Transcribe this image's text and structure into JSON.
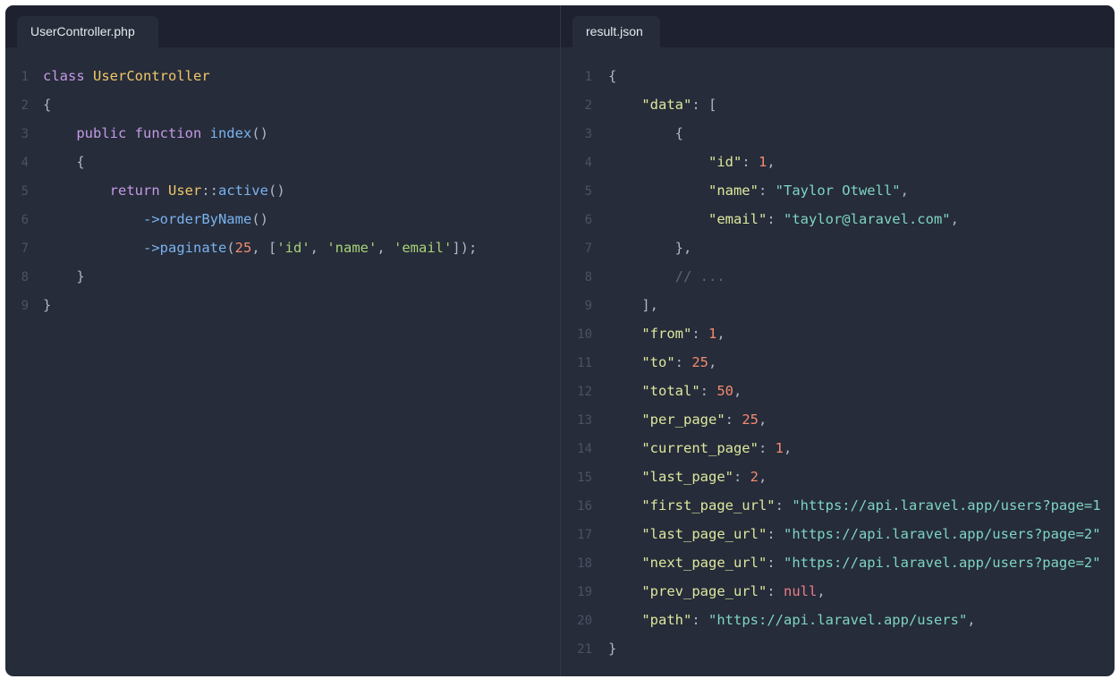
{
  "left_tab": {
    "label": "UserController.php"
  },
  "right_tab": {
    "label": "result.json"
  },
  "php_lines": [
    [
      {
        "t": "class ",
        "c": "kw"
      },
      {
        "t": "UserController",
        "c": "cls"
      }
    ],
    [
      {
        "t": "{",
        "c": "pun"
      }
    ],
    [
      {
        "t": "    public function ",
        "c": "kw"
      },
      {
        "t": "index",
        "c": "fn"
      },
      {
        "t": "()",
        "c": "pun"
      }
    ],
    [
      {
        "t": "    {",
        "c": "pun"
      }
    ],
    [
      {
        "t": "        return ",
        "c": "kw"
      },
      {
        "t": "User",
        "c": "cls"
      },
      {
        "t": "::",
        "c": "pun"
      },
      {
        "t": "active",
        "c": "fn"
      },
      {
        "t": "()",
        "c": "pun"
      }
    ],
    [
      {
        "t": "            ->",
        "c": "fn"
      },
      {
        "t": "orderByName",
        "c": "fn"
      },
      {
        "t": "()",
        "c": "pun"
      }
    ],
    [
      {
        "t": "            ->",
        "c": "fn"
      },
      {
        "t": "paginate",
        "c": "fn"
      },
      {
        "t": "(",
        "c": "pun"
      },
      {
        "t": "25",
        "c": "num"
      },
      {
        "t": ", [",
        "c": "pun"
      },
      {
        "t": "'id'",
        "c": "str"
      },
      {
        "t": ", ",
        "c": "pun"
      },
      {
        "t": "'name'",
        "c": "str"
      },
      {
        "t": ", ",
        "c": "pun"
      },
      {
        "t": "'email'",
        "c": "str"
      },
      {
        "t": "]);",
        "c": "pun"
      }
    ],
    [
      {
        "t": "    }",
        "c": "pun"
      }
    ],
    [
      {
        "t": "}",
        "c": "pun"
      }
    ]
  ],
  "json_lines": [
    [
      {
        "t": "{",
        "c": "pun"
      }
    ],
    [
      {
        "t": "    \"data\"",
        "c": "key"
      },
      {
        "t": ": [",
        "c": "pun"
      }
    ],
    [
      {
        "t": "        {",
        "c": "pun"
      }
    ],
    [
      {
        "t": "            \"id\"",
        "c": "key"
      },
      {
        "t": ": ",
        "c": "pun"
      },
      {
        "t": "1",
        "c": "num"
      },
      {
        "t": ",",
        "c": "pun"
      }
    ],
    [
      {
        "t": "            \"name\"",
        "c": "key"
      },
      {
        "t": ": ",
        "c": "pun"
      },
      {
        "t": "\"Taylor Otwell\"",
        "c": "val"
      },
      {
        "t": ",",
        "c": "pun"
      }
    ],
    [
      {
        "t": "            \"email\"",
        "c": "key"
      },
      {
        "t": ": ",
        "c": "pun"
      },
      {
        "t": "\"taylor@laravel.com\"",
        "c": "val"
      },
      {
        "t": ",",
        "c": "pun"
      }
    ],
    [
      {
        "t": "        },",
        "c": "pun"
      }
    ],
    [
      {
        "t": "        // ...",
        "c": "cmt"
      }
    ],
    [
      {
        "t": "    ],",
        "c": "pun"
      }
    ],
    [
      {
        "t": "    \"from\"",
        "c": "key"
      },
      {
        "t": ": ",
        "c": "pun"
      },
      {
        "t": "1",
        "c": "num"
      },
      {
        "t": ",",
        "c": "pun"
      }
    ],
    [
      {
        "t": "    \"to\"",
        "c": "key"
      },
      {
        "t": ": ",
        "c": "pun"
      },
      {
        "t": "25",
        "c": "num"
      },
      {
        "t": ",",
        "c": "pun"
      }
    ],
    [
      {
        "t": "    \"total\"",
        "c": "key"
      },
      {
        "t": ": ",
        "c": "pun"
      },
      {
        "t": "50",
        "c": "num"
      },
      {
        "t": ",",
        "c": "pun"
      }
    ],
    [
      {
        "t": "    \"per_page\"",
        "c": "key"
      },
      {
        "t": ": ",
        "c": "pun"
      },
      {
        "t": "25",
        "c": "num"
      },
      {
        "t": ",",
        "c": "pun"
      }
    ],
    [
      {
        "t": "    \"current_page\"",
        "c": "key"
      },
      {
        "t": ": ",
        "c": "pun"
      },
      {
        "t": "1",
        "c": "num"
      },
      {
        "t": ",",
        "c": "pun"
      }
    ],
    [
      {
        "t": "    \"last_page\"",
        "c": "key"
      },
      {
        "t": ": ",
        "c": "pun"
      },
      {
        "t": "2",
        "c": "num"
      },
      {
        "t": ",",
        "c": "pun"
      }
    ],
    [
      {
        "t": "    \"first_page_url\"",
        "c": "key"
      },
      {
        "t": ": ",
        "c": "pun"
      },
      {
        "t": "\"https://api.laravel.app/users?page=1",
        "c": "val"
      }
    ],
    [
      {
        "t": "    \"last_page_url\"",
        "c": "key"
      },
      {
        "t": ": ",
        "c": "pun"
      },
      {
        "t": "\"https://api.laravel.app/users?page=2\"",
        "c": "val"
      }
    ],
    [
      {
        "t": "    \"next_page_url\"",
        "c": "key"
      },
      {
        "t": ": ",
        "c": "pun"
      },
      {
        "t": "\"https://api.laravel.app/users?page=2\"",
        "c": "val"
      }
    ],
    [
      {
        "t": "    \"prev_page_url\"",
        "c": "key"
      },
      {
        "t": ": ",
        "c": "pun"
      },
      {
        "t": "null",
        "c": "nul"
      },
      {
        "t": ",",
        "c": "pun"
      }
    ],
    [
      {
        "t": "    \"path\"",
        "c": "key"
      },
      {
        "t": ": ",
        "c": "pun"
      },
      {
        "t": "\"https://api.laravel.app/users\"",
        "c": "val"
      },
      {
        "t": ",",
        "c": "pun"
      }
    ],
    [
      {
        "t": "}",
        "c": "pun"
      }
    ]
  ]
}
